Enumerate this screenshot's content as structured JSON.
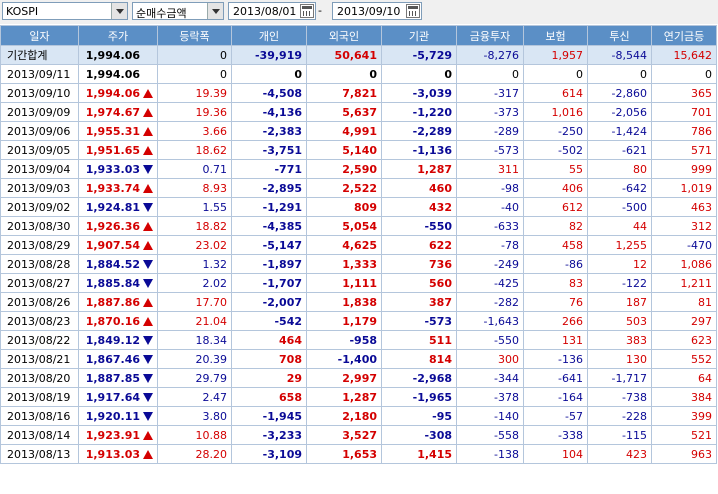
{
  "toolbar": {
    "market": "KOSPI",
    "metric": "순매수금액",
    "start_date": "2013/08/01",
    "separator": "-",
    "end_date": "2013/09/10"
  },
  "columns": [
    "일자",
    "주가",
    "등락폭",
    "개인",
    "외국인",
    "기관",
    "금융투자",
    "보험",
    "투신",
    "연기금등"
  ],
  "colors": {
    "header_bg": "#5b8fc6",
    "up": "#d40000",
    "down": "#0a0a96",
    "summary_bg": "#d9e6f4"
  },
  "rows": [
    {
      "date": "기간합계",
      "price": "1,994.06",
      "dir": "none",
      "change": "0",
      "indiv": "-39,919",
      "foreign": "50,641",
      "inst": "-5,729",
      "fininv": "-8,276",
      "insur": "1,957",
      "trust": "-8,544",
      "pension": "15,642",
      "type": "sum"
    },
    {
      "date": "2013/09/11",
      "price": "1,994.06",
      "dir": "none",
      "change": "0",
      "indiv": "0",
      "foreign": "0",
      "inst": "0",
      "fininv": "0",
      "insur": "0",
      "trust": "0",
      "pension": "0",
      "type": "zero"
    },
    {
      "date": "2013/09/10",
      "price": "1,994.06",
      "dir": "up",
      "change": "19.39",
      "indiv": "-4,508",
      "foreign": "7,821",
      "inst": "-3,039",
      "fininv": "-317",
      "insur": "614",
      "trust": "-2,860",
      "pension": "365"
    },
    {
      "date": "2013/09/09",
      "price": "1,974.67",
      "dir": "up",
      "change": "19.36",
      "indiv": "-4,136",
      "foreign": "5,637",
      "inst": "-1,220",
      "fininv": "-373",
      "insur": "1,016",
      "trust": "-2,056",
      "pension": "701"
    },
    {
      "date": "2013/09/06",
      "price": "1,955.31",
      "dir": "up",
      "change": "3.66",
      "indiv": "-2,383",
      "foreign": "4,991",
      "inst": "-2,289",
      "fininv": "-289",
      "insur": "-250",
      "trust": "-1,424",
      "pension": "786"
    },
    {
      "date": "2013/09/05",
      "price": "1,951.65",
      "dir": "up",
      "change": "18.62",
      "indiv": "-3,751",
      "foreign": "5,140",
      "inst": "-1,136",
      "fininv": "-573",
      "insur": "-502",
      "trust": "-621",
      "pension": "571"
    },
    {
      "date": "2013/09/04",
      "price": "1,933.03",
      "dir": "down",
      "change": "0.71",
      "indiv": "-771",
      "foreign": "2,590",
      "inst": "1,287",
      "fininv": "311",
      "insur": "55",
      "trust": "80",
      "pension": "999"
    },
    {
      "date": "2013/09/03",
      "price": "1,933.74",
      "dir": "up",
      "change": "8.93",
      "indiv": "-2,895",
      "foreign": "2,522",
      "inst": "460",
      "fininv": "-98",
      "insur": "406",
      "trust": "-642",
      "pension": "1,019"
    },
    {
      "date": "2013/09/02",
      "price": "1,924.81",
      "dir": "down",
      "change": "1.55",
      "indiv": "-1,291",
      "foreign": "809",
      "inst": "432",
      "fininv": "-40",
      "insur": "612",
      "trust": "-500",
      "pension": "463"
    },
    {
      "date": "2013/08/30",
      "price": "1,926.36",
      "dir": "up",
      "change": "18.82",
      "indiv": "-4,385",
      "foreign": "5,054",
      "inst": "-550",
      "fininv": "-633",
      "insur": "82",
      "trust": "44",
      "pension": "312"
    },
    {
      "date": "2013/08/29",
      "price": "1,907.54",
      "dir": "up",
      "change": "23.02",
      "indiv": "-5,147",
      "foreign": "4,625",
      "inst": "622",
      "fininv": "-78",
      "insur": "458",
      "trust": "1,255",
      "pension": "-470"
    },
    {
      "date": "2013/08/28",
      "price": "1,884.52",
      "dir": "down",
      "change": "1.32",
      "indiv": "-1,897",
      "foreign": "1,333",
      "inst": "736",
      "fininv": "-249",
      "insur": "-86",
      "trust": "12",
      "pension": "1,086"
    },
    {
      "date": "2013/08/27",
      "price": "1,885.84",
      "dir": "down",
      "change": "2.02",
      "indiv": "-1,707",
      "foreign": "1,111",
      "inst": "560",
      "fininv": "-425",
      "insur": "83",
      "trust": "-122",
      "pension": "1,211"
    },
    {
      "date": "2013/08/26",
      "price": "1,887.86",
      "dir": "up",
      "change": "17.70",
      "indiv": "-2,007",
      "foreign": "1,838",
      "inst": "387",
      "fininv": "-282",
      "insur": "76",
      "trust": "187",
      "pension": "81"
    },
    {
      "date": "2013/08/23",
      "price": "1,870.16",
      "dir": "up",
      "change": "21.04",
      "indiv": "-542",
      "foreign": "1,179",
      "inst": "-573",
      "fininv": "-1,643",
      "insur": "266",
      "trust": "503",
      "pension": "297"
    },
    {
      "date": "2013/08/22",
      "price": "1,849.12",
      "dir": "down",
      "change": "18.34",
      "indiv": "464",
      "foreign": "-958",
      "inst": "511",
      "fininv": "-550",
      "insur": "131",
      "trust": "383",
      "pension": "623"
    },
    {
      "date": "2013/08/21",
      "price": "1,867.46",
      "dir": "down",
      "change": "20.39",
      "indiv": "708",
      "foreign": "-1,400",
      "inst": "814",
      "fininv": "300",
      "insur": "-136",
      "trust": "130",
      "pension": "552"
    },
    {
      "date": "2013/08/20",
      "price": "1,887.85",
      "dir": "down",
      "change": "29.79",
      "indiv": "29",
      "foreign": "2,997",
      "inst": "-2,968",
      "fininv": "-344",
      "insur": "-641",
      "trust": "-1,717",
      "pension": "64"
    },
    {
      "date": "2013/08/19",
      "price": "1,917.64",
      "dir": "down",
      "change": "2.47",
      "indiv": "658",
      "foreign": "1,287",
      "inst": "-1,965",
      "fininv": "-378",
      "insur": "-164",
      "trust": "-738",
      "pension": "384"
    },
    {
      "date": "2013/08/16",
      "price": "1,920.11",
      "dir": "down",
      "change": "3.80",
      "indiv": "-1,945",
      "foreign": "2,180",
      "inst": "-95",
      "fininv": "-140",
      "insur": "-57",
      "trust": "-228",
      "pension": "399"
    },
    {
      "date": "2013/08/14",
      "price": "1,923.91",
      "dir": "up",
      "change": "10.88",
      "indiv": "-3,233",
      "foreign": "3,527",
      "inst": "-308",
      "fininv": "-558",
      "insur": "-338",
      "trust": "-115",
      "pension": "521"
    },
    {
      "date": "2013/08/13",
      "price": "1,913.03",
      "dir": "up",
      "change": "28.20",
      "indiv": "-3,109",
      "foreign": "1,653",
      "inst": "1,415",
      "fininv": "-138",
      "insur": "104",
      "trust": "423",
      "pension": "963"
    }
  ]
}
